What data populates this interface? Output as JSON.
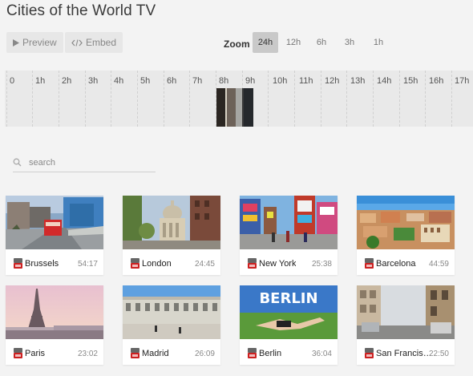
{
  "title": "Cities of the World TV",
  "toolbar": {
    "preview_label": "Preview",
    "embed_label": "Embed"
  },
  "zoom": {
    "label": "Zoom",
    "options": [
      "24h",
      "12h",
      "6h",
      "3h",
      "1h"
    ],
    "selected": "24h"
  },
  "timeline": {
    "hours": [
      "0",
      "1h",
      "2h",
      "3h",
      "4h",
      "5h",
      "6h",
      "7h",
      "8h",
      "9h",
      "10h",
      "11h",
      "12h",
      "13h",
      "14h",
      "15h",
      "16h",
      "17h"
    ]
  },
  "search": {
    "placeholder": "search",
    "value": ""
  },
  "videos": [
    {
      "city": "Brussels",
      "duration": "54:17"
    },
    {
      "city": "London",
      "duration": "24:45"
    },
    {
      "city": "New York",
      "duration": "25:38"
    },
    {
      "city": "Barcelona",
      "duration": "44:59"
    },
    {
      "city": "Paris",
      "duration": "23:02"
    },
    {
      "city": "Madrid",
      "duration": "26:09"
    },
    {
      "city": "Berlin",
      "duration": "36:04",
      "thumb_text": "BERLIN"
    },
    {
      "city": "San Francis…",
      "duration": "22:50"
    }
  ]
}
